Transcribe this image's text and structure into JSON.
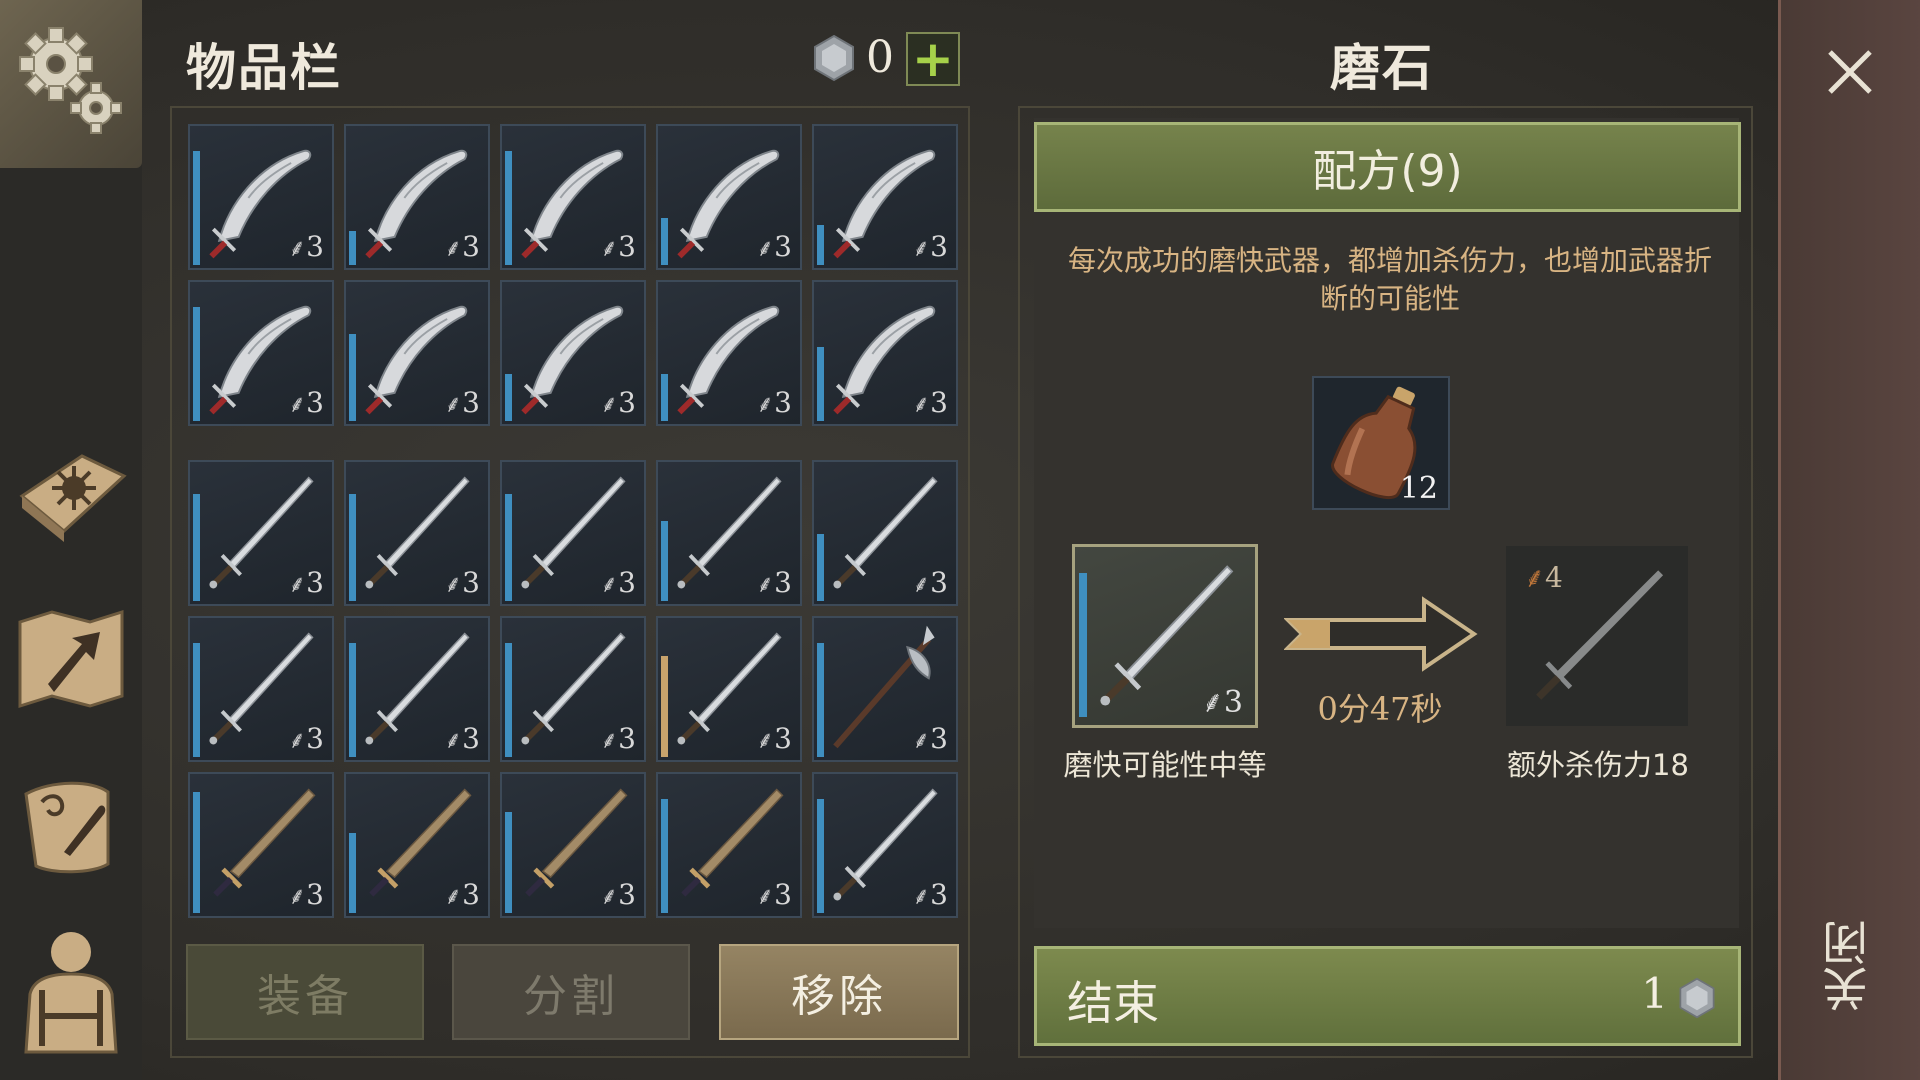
{
  "inventory": {
    "title": "物品栏",
    "currency_amount": "0",
    "add_label": "+",
    "slots": [
      {
        "weapon": "scimitar",
        "level": "3",
        "durability": 0.85
      },
      {
        "weapon": "scimitar",
        "level": "3",
        "durability": 0.25
      },
      {
        "weapon": "scimitar",
        "level": "3",
        "durability": 0.85
      },
      {
        "weapon": "scimitar",
        "level": "3",
        "durability": 0.35
      },
      {
        "weapon": "scimitar",
        "level": "3",
        "durability": 0.3
      },
      {
        "weapon": "scimitar",
        "level": "3",
        "durability": 0.85
      },
      {
        "weapon": "scimitar",
        "level": "3",
        "durability": 0.65
      },
      {
        "weapon": "scimitar",
        "level": "3",
        "durability": 0.35
      },
      {
        "weapon": "scimitar",
        "level": "3",
        "durability": 0.35
      },
      {
        "weapon": "scimitar",
        "level": "3",
        "durability": 0.55
      },
      {
        "weapon": "longsword",
        "level": "3",
        "durability": 0.8
      },
      {
        "weapon": "longsword",
        "level": "3",
        "durability": 0.8
      },
      {
        "weapon": "longsword",
        "level": "3",
        "durability": 0.8
      },
      {
        "weapon": "longsword",
        "level": "3",
        "durability": 0.6
      },
      {
        "weapon": "longsword",
        "level": "3",
        "durability": 0.5
      },
      {
        "weapon": "longsword",
        "level": "3",
        "durability": 0.85
      },
      {
        "weapon": "longsword",
        "level": "3",
        "durability": 0.85
      },
      {
        "weapon": "longsword",
        "level": "3",
        "durability": 0.85
      },
      {
        "weapon": "longsword",
        "level": "3",
        "durability": 0.75,
        "durability_color": "#c8a36c"
      },
      {
        "weapon": "halberd",
        "level": "3",
        "durability": 0.85
      },
      {
        "weapon": "bronze-sword",
        "level": "3",
        "durability": 0.9
      },
      {
        "weapon": "bronze-sword",
        "level": "3",
        "durability": 0.6
      },
      {
        "weapon": "bronze-sword",
        "level": "3",
        "durability": 0.75
      },
      {
        "weapon": "bronze-sword",
        "level": "3",
        "durability": 0.85
      },
      {
        "weapon": "longsword",
        "level": "3",
        "durability": 0.85
      }
    ],
    "buttons": {
      "equip": "装备",
      "split": "分割",
      "remove": "移除"
    }
  },
  "craft": {
    "title": "磨石",
    "recipe_label": "配方(9)",
    "description": "每次成功的磨快武器，都增加杀伤力，也增加武器折断的可能性",
    "ingredient": {
      "icon": "oil-bottle-icon",
      "count": "12"
    },
    "input": {
      "weapon": "longsword",
      "level": "3",
      "durability": 0.9,
      "caption": "磨快可能性中等"
    },
    "timer": "0分47秒",
    "output": {
      "weapon": "longsword",
      "level": "4",
      "caption": "额外杀伤力18"
    },
    "end_label": "结束",
    "end_cost": "1"
  },
  "close_label": "关闭",
  "colors": {
    "durability": "#3f8fc0",
    "accent_green": "#76834c",
    "active_button": "#958463"
  }
}
